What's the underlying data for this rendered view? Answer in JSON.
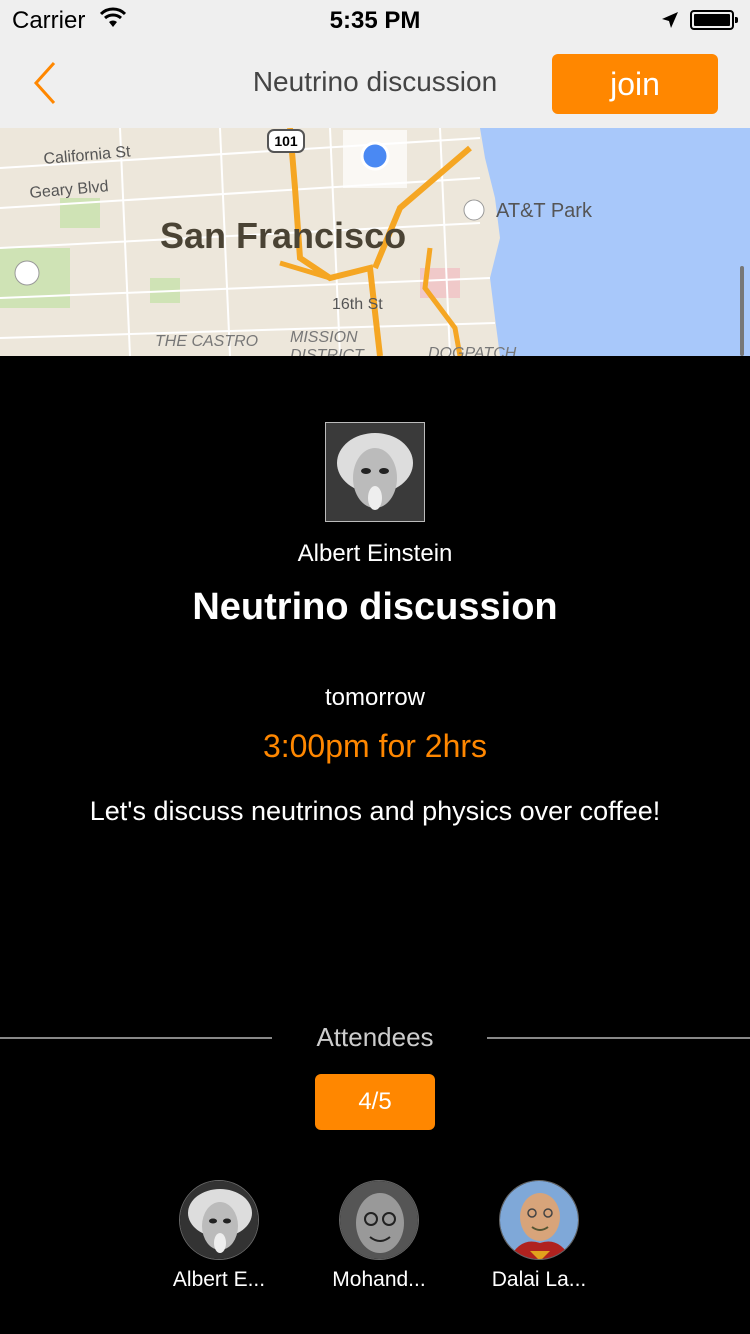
{
  "status_bar": {
    "carrier": "Carrier",
    "time": "5:35 PM"
  },
  "nav": {
    "title": "Neutrino discussion",
    "join_label": "join",
    "accent_color": "#ff8700"
  },
  "map": {
    "labels": {
      "street1": "California St",
      "street2": "Geary Blvd",
      "city": "San Francisco",
      "poi": "AT&T Park",
      "street3": "16th St",
      "district1": "THE CASTRO",
      "district2": "MISSION",
      "district2b": "DISTRICT",
      "district3": "DOGPATCH",
      "highway": "101"
    }
  },
  "event": {
    "host_name": "Albert Einstein",
    "title": "Neutrino discussion",
    "day": "tomorrow",
    "time": "3:00pm for 2hrs",
    "description": "Let's discuss neutrinos and physics over coffee!"
  },
  "attendees": {
    "label": "Attendees",
    "count": "4/5",
    "people": [
      {
        "name": "Albert E..."
      },
      {
        "name": "Mohand..."
      },
      {
        "name": "Dalai La..."
      }
    ]
  }
}
